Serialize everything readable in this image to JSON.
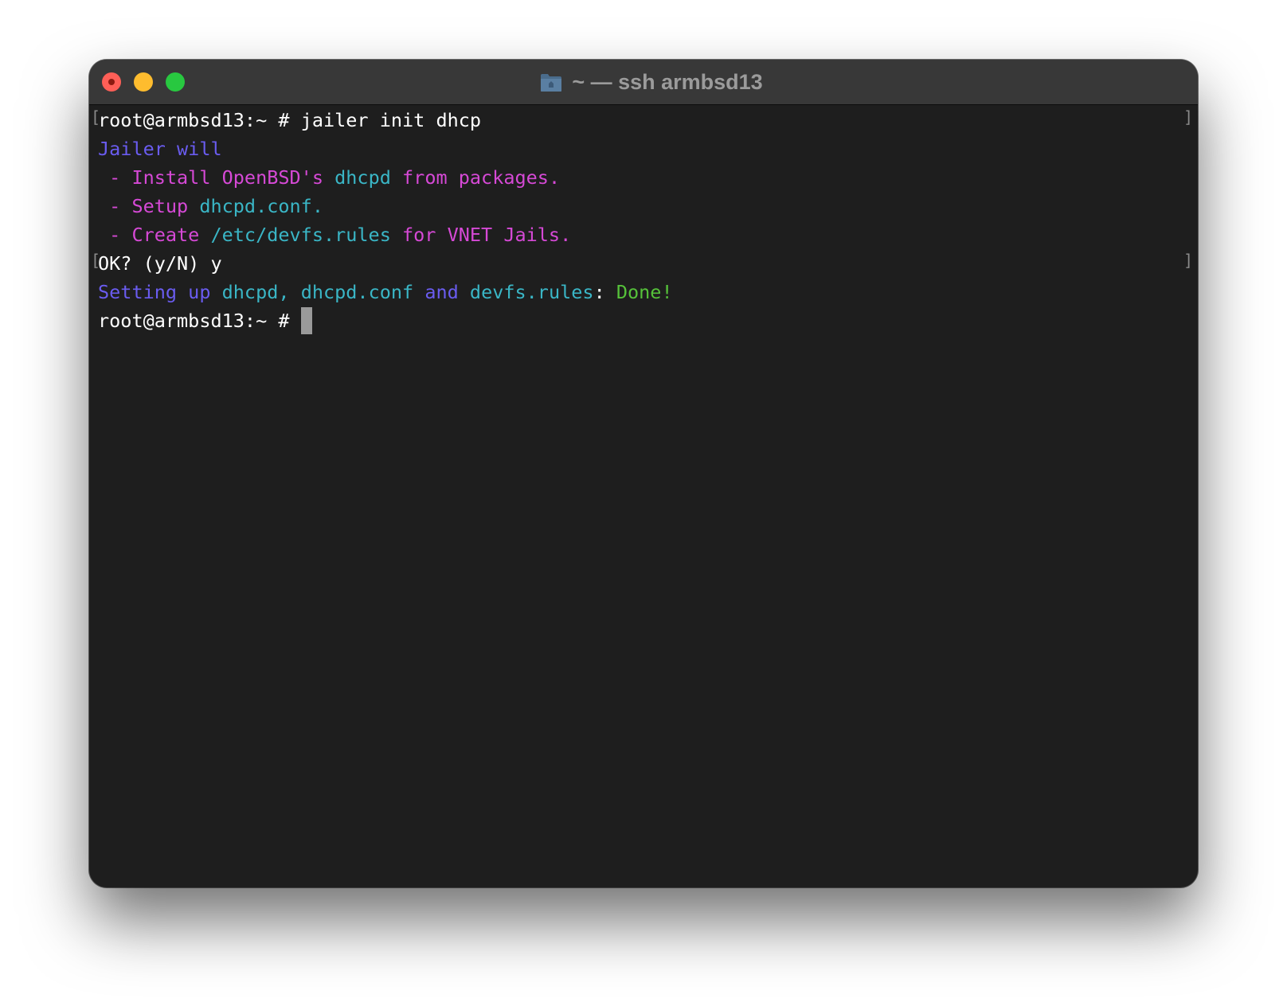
{
  "window": {
    "title": "~ — ssh armbsd13",
    "title_icon": "folder-icon"
  },
  "colors": {
    "purple": "#6a5cf0",
    "magenta": "#d649d6",
    "cyan": "#3ab6c6",
    "green": "#56c23a",
    "background": "#1e1e1e"
  },
  "terminal": {
    "line1": {
      "prompt": "root@armbsd13:~ # ",
      "command": "jailer init dhcp"
    },
    "line2": {
      "text": "Jailer will"
    },
    "line3": {
      "a": " - Install OpenBSD's ",
      "b": "dhcpd",
      "c": " from packages."
    },
    "line4": {
      "a": " - Setup ",
      "b": "dhcpd.conf."
    },
    "line5": {
      "a": " - Create ",
      "b": "/etc/devfs.rules",
      "c": " for VNET Jails."
    },
    "line6": {
      "text": "OK? (y/N) y"
    },
    "line7": {
      "a": "Setting up ",
      "b": "dhcpd,",
      "c": " ",
      "d": "dhcpd.conf",
      "e": " and ",
      "f": "devfs.rules",
      "g": ": ",
      "h": "Done!"
    },
    "line8": {
      "prompt": "root@armbsd13:~ # "
    }
  }
}
